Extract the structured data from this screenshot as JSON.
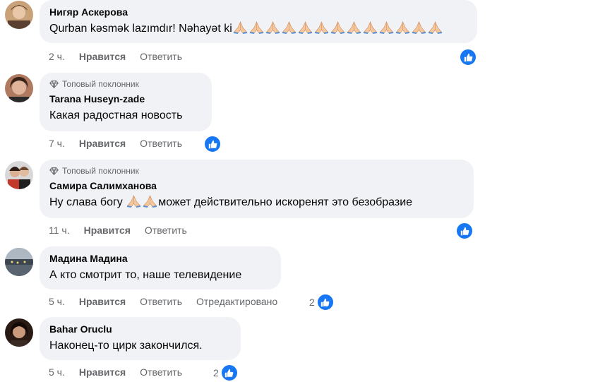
{
  "comments": [
    {
      "author": "Нигяр Аскерова",
      "badge": "",
      "text": "Qurban kəsmək lazımdır! Nəhayət ki",
      "text_after": "",
      "emoji": "folded-hands",
      "emoji_count": 13,
      "time": "2 ч.",
      "like_label": "Нравится",
      "reply_label": "Ответить",
      "edited_label": "",
      "reaction_count": "",
      "reaction_icon": "like-icon"
    },
    {
      "author": "Tarana Huseyn-zade",
      "badge": "Топовый поклонник",
      "text": "Какая радостная новость",
      "text_after": "",
      "emoji": "",
      "emoji_count": 0,
      "time": "7 ч.",
      "like_label": "Нравится",
      "reply_label": "Ответить",
      "edited_label": "",
      "reaction_count": "",
      "reaction_icon": "like-icon"
    },
    {
      "author": "Самира Салимханова",
      "badge": "Топовый поклонник",
      "text": "Ну слава богу ",
      "text_after": "может действительно искоренят это безобразие",
      "emoji": "folded-hands",
      "emoji_count": 2,
      "time": "11 ч.",
      "like_label": "Нравится",
      "reply_label": "Ответить",
      "edited_label": "",
      "reaction_count": "",
      "reaction_icon": "like-icon"
    },
    {
      "author": "Мадина Мадина",
      "badge": "",
      "text": "А кто смотрит то, наше телевидение",
      "text_after": "",
      "emoji": "",
      "emoji_count": 0,
      "time": "5 ч.",
      "like_label": "Нравится",
      "reply_label": "Ответить",
      "edited_label": "Отредактировано",
      "reaction_count": "2",
      "reaction_icon": "like-icon"
    },
    {
      "author": "Bahar Oruclu",
      "badge": "",
      "text": "Наконец-то цирк закончился.",
      "text_after": "",
      "emoji": "",
      "emoji_count": 0,
      "time": "5 ч.",
      "like_label": "Нравится",
      "reply_label": "Ответить",
      "edited_label": "",
      "reaction_count": "2",
      "reaction_icon": "like-icon"
    }
  ],
  "colors": {
    "bubble": "#f0f2f5",
    "meta_text": "#65676b",
    "like_blue": "#1877f2"
  }
}
